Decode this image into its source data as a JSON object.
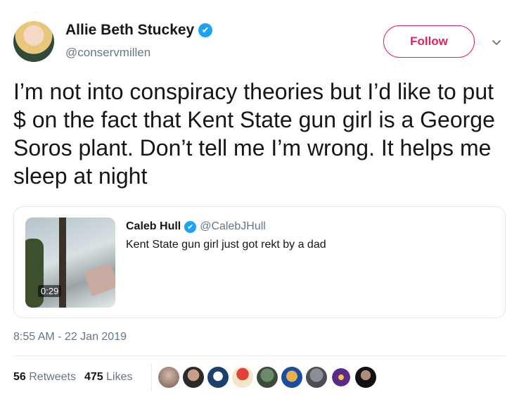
{
  "author": {
    "name": "Allie Beth Stuckey",
    "handle": "@conservmillen",
    "verified_icon": "✔"
  },
  "follow_label": "Follow",
  "tweet_text": "I’m not into conspiracy theories but I’d like to put $ on the fact that Kent State gun girl is a George Soros plant. Don’t tell me I’m wrong. It helps me sleep at night",
  "quoted": {
    "name": "Caleb Hull",
    "handle": "@CalebJHull",
    "text": "Kent State gun girl just got rekt by a dad",
    "duration": "0:29"
  },
  "timestamp": "8:55 AM - 22 Jan 2019",
  "stats": {
    "retweets_count": "56",
    "retweets_label": "Retweets",
    "likes_count": "475",
    "likes_label": "Likes"
  },
  "colors": {
    "follow": "#e0245e",
    "verified": "#1da1f2",
    "secondary_text": "#657786"
  }
}
